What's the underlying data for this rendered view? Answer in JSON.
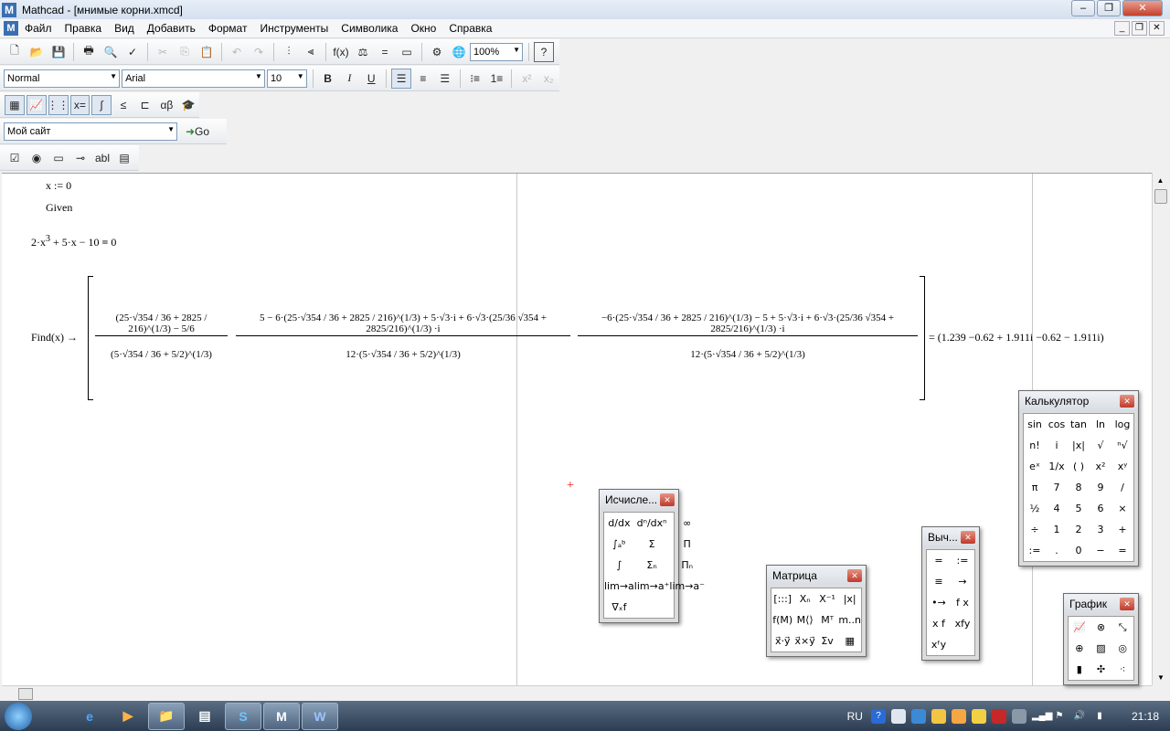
{
  "window": {
    "title": "Mathcad - [мнимые корни.xmcd]",
    "app_letter": "M",
    "minimize": "–",
    "maximize": "❐",
    "close": "✕"
  },
  "menu": [
    "Файл",
    "Правка",
    "Вид",
    "Добавить",
    "Формат",
    "Инструменты",
    "Символика",
    "Окно",
    "Справка"
  ],
  "standard_toolbar": {
    "zoom": "100%",
    "help": "?"
  },
  "format_toolbar": {
    "style": "Normal",
    "font": "Arial",
    "size": "10",
    "bold": "B",
    "italic": "I",
    "underline": "U"
  },
  "web_toolbar": {
    "address": "Мой сайт",
    "go": "Go"
  },
  "worksheet": {
    "line1": "x := 0",
    "given": "Given",
    "equation": {
      "a": "2·x",
      "a_exp": "3",
      "b": "+ 5·x − 10",
      "eq": "=",
      "rhs": "0"
    },
    "find_label": "Find(x) →",
    "result": "= (1.239   −0.62 + 1.911i   −0.62 − 1.911i)",
    "cursor": "+",
    "find_elems": {
      "e1_num": "(25·√354 / 36 + 2825 / 216)^(1/3) − 5/6",
      "e1_den": "(5·√354 / 36 + 5/2)^(1/3)",
      "e2_num": "5 − 6·(25·√354 / 36 + 2825 / 216)^(1/3) + 5·√3·i + 6·√3·(25/36 √354 + 2825/216)^(1/3) ·i",
      "e2_den": "12·(5·√354 / 36 + 5/2)^(1/3)",
      "e3_num": "−6·(25·√354 / 36 + 2825 / 216)^(1/3) − 5 + 5·√3·i + 6·√3·(25/36 √354 + 2825/216)^(1/3) ·i",
      "e3_den": "12·(5·√354 / 36 + 5/2)^(1/3)"
    }
  },
  "palettes": {
    "calculus": {
      "title": "Исчисле...",
      "close": "✕",
      "cells": [
        "d/dx",
        "dⁿ/dxⁿ",
        "∞",
        "∫ₐᵇ",
        "Σ",
        "Π",
        "∫",
        "Σₙ",
        "Πₙ",
        "lim→a",
        "lim→a⁺",
        "lim→a⁻",
        "∇ₓf"
      ]
    },
    "matrix": {
      "title": "Матрица",
      "close": "✕",
      "cells": [
        "[:::]",
        "Xₙ",
        "X⁻¹",
        "|x|",
        "f(M)",
        "M⟨⟩",
        "Mᵀ",
        "m..n",
        "x⃗·y⃗",
        "x⃗×y⃗",
        "Σv",
        "▦"
      ]
    },
    "evaluation": {
      "title": "Выч...",
      "close": "✕",
      "cells": [
        "=",
        ":=",
        "≡",
        "→",
        "•→",
        "f x",
        "x f",
        "xfy",
        "xᶠy"
      ]
    },
    "calculator": {
      "title": "Калькулятор",
      "close": "✕",
      "cells": [
        "sin",
        "cos",
        "tan",
        "ln",
        "log",
        "n!",
        "i",
        "|x|",
        "√",
        "ⁿ√",
        "eˣ",
        "1/x",
        "( )",
        "x²",
        "xʸ",
        "π",
        "7",
        "8",
        "9",
        "/",
        "½",
        "4",
        "5",
        "6",
        "×",
        "÷",
        "1",
        "2",
        "3",
        "+",
        ":=",
        ".",
        "0",
        "−",
        "="
      ]
    },
    "graph": {
      "title": "График",
      "close": "✕",
      "cells": [
        "📈",
        "⊗",
        "⤡",
        "⊕",
        "▨",
        "◎",
        "▮",
        "✣",
        "⁖"
      ]
    }
  },
  "taskbar": {
    "lang": "RU",
    "time": "21:18",
    "apps": [
      "e",
      "▶",
      "📁",
      "▤",
      "S",
      "M",
      "W"
    ]
  }
}
